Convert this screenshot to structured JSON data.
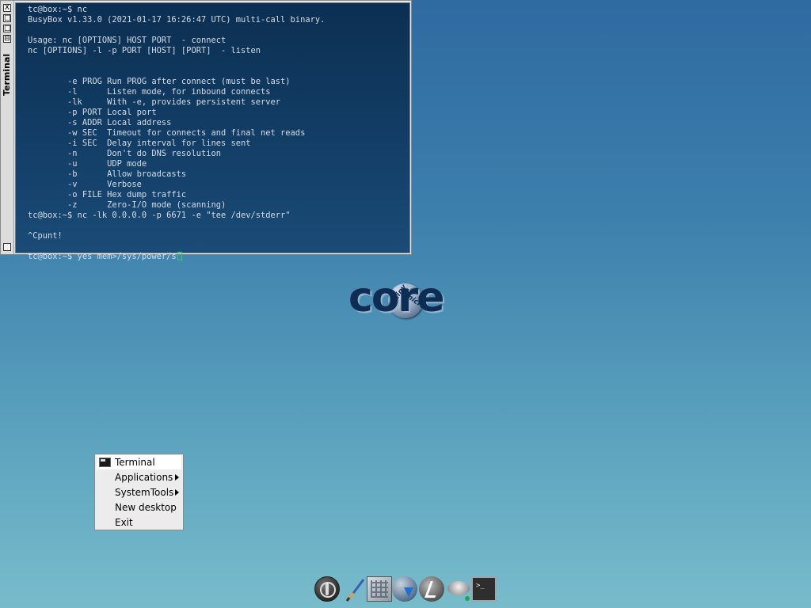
{
  "terminal": {
    "title": "Terminal",
    "controls": {
      "close": "X",
      "iconify": "□",
      "maximize": "□",
      "shade": "⊟"
    },
    "lines": [
      "tc@box:~$ nc",
      "BusyBox v1.33.0 (2021-01-17 16:26:47 UTC) multi-call binary.",
      "",
      "Usage: nc [OPTIONS] HOST PORT  - connect",
      "nc [OPTIONS] -l -p PORT [HOST] [PORT]  - listen",
      "",
      "",
      "        -e PROG Run PROG after connect (must be last)",
      "        -l      Listen mode, for inbound connects",
      "        -lk     With -e, provides persistent server",
      "        -p PORT Local port",
      "        -s ADDR Local address",
      "        -w SEC  Timeout for connects and final net reads",
      "        -i SEC  Delay interval for lines sent",
      "        -n      Don't do DNS resolution",
      "        -u      UDP mode",
      "        -b      Allow broadcasts",
      "        -v      Verbose",
      "        -o FILE Hex dump traffic",
      "        -z      Zero-I/O mode (scanning)",
      "tc@box:~$ nc -lk 0.0.0.0 -p 6671 -e \"tee /dev/stderr\"",
      "",
      "^Cpunt!",
      ""
    ],
    "current_prompt": "tc@box:~$ yes mem>/sys/power/s",
    "cursor_color": "#33d06a"
  },
  "logo": {
    "main": "core",
    "tiny": "tiny",
    "micro": "micro"
  },
  "context_menu": {
    "items": [
      {
        "label": "Terminal",
        "icon": "terminal-icon",
        "submenu": false,
        "selected": true
      },
      {
        "label": "Applications",
        "submenu": true
      },
      {
        "label": "SystemTools",
        "submenu": true
      },
      {
        "label": "New desktop",
        "submenu": false
      },
      {
        "label": "Exit",
        "submenu": false
      }
    ]
  },
  "dock": {
    "items": [
      {
        "icon": "power-icon"
      },
      {
        "icon": "paintbrush-icon"
      },
      {
        "icon": "apps-icon"
      },
      {
        "icon": "mount-tool-icon"
      },
      {
        "icon": "run-icon"
      },
      {
        "icon": "control-panel-icon"
      },
      {
        "icon": "terminal-icon",
        "glyph": ">_"
      }
    ]
  },
  "colors": {
    "desktop_top": "#2f6aa0",
    "desktop_bottom": "#78bccb",
    "terminal_bg": "#0c2f52",
    "terminal_fg": "#d5dde6"
  }
}
